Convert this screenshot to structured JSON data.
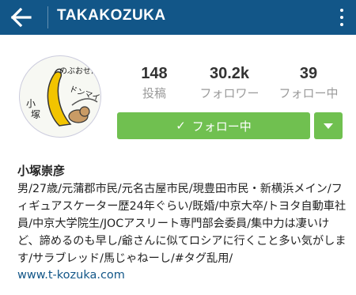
{
  "header": {
    "title": "TAKAKOZUKA",
    "background": "#125688"
  },
  "profile": {
    "avatar_text": {
      "line1": "のぶおせんせ",
      "line2": "ドンマイ",
      "left1": "小",
      "left2": "塚"
    },
    "stats": [
      {
        "value": "148",
        "label": "投稿"
      },
      {
        "value": "30.2k",
        "label": "フォロワー"
      },
      {
        "value": "39",
        "label": "フォロー中"
      }
    ],
    "follow_button": "フォロー中",
    "button_color": "#70c050",
    "name": "小塚崇彦",
    "bio": "男/27歳/元蒲郡市民/元名古屋市民/現豊田市民・新横浜メイン/フィギュアスケーター歴24年ぐらい/既婚/中京大卒/トヨタ自動車社員/中京大学院生/JOCアスリート専門部会委員/集中力は凄いけど、諦めるのも早し/爺さんに似てロシアに行くこと多い気がします/サラブレッド/馬じゃねーし/#タグ乱用/",
    "website": "www.t-kozuka.com"
  }
}
